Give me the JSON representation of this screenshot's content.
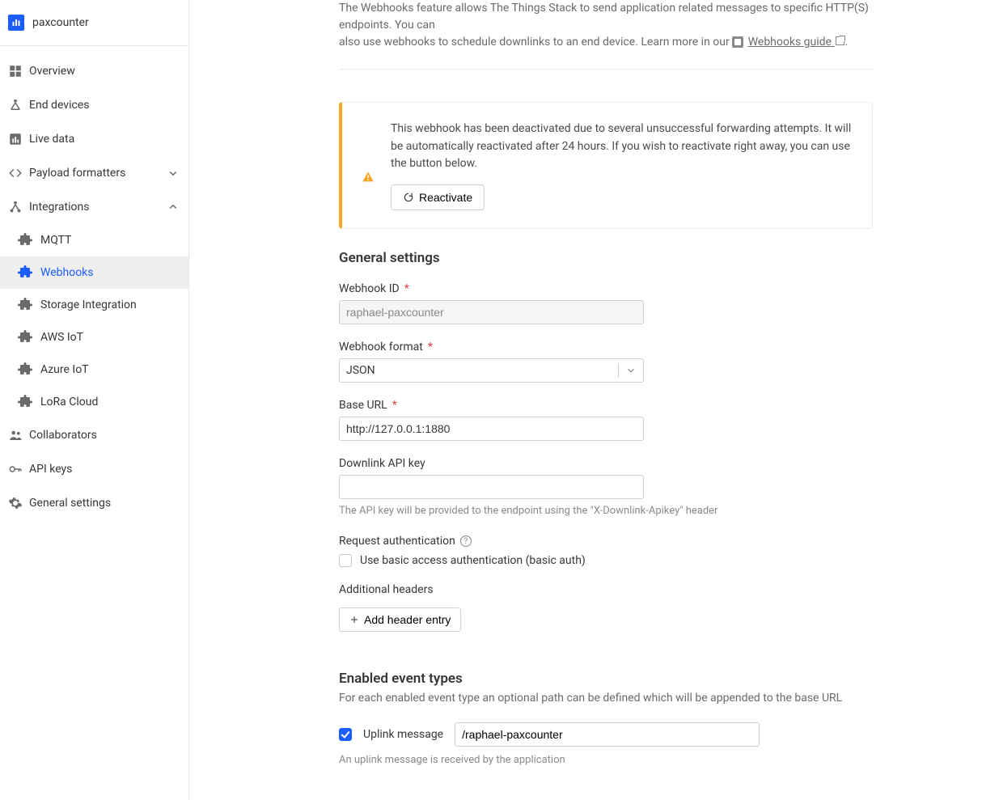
{
  "sidebar": {
    "app_name": "paxcounter",
    "items": {
      "overview": "Overview",
      "end_devices": "End devices",
      "live_data": "Live data",
      "payload_formatters": "Payload formatters",
      "integrations": "Integrations",
      "collaborators": "Collaborators",
      "api_keys": "API keys",
      "general_settings": "General settings"
    },
    "integrations": {
      "mqtt": "MQTT",
      "webhooks": "Webhooks",
      "storage_integration": "Storage Integration",
      "aws_iot": "AWS IoT",
      "azure_iot": "Azure IoT",
      "lora_cloud": "LoRa Cloud"
    }
  },
  "intro": {
    "line1": "The Webhooks feature allows The Things Stack to send application related messages to specific HTTP(S) endpoints. You can",
    "line2_prefix": "also use webhooks to schedule downlinks to an end device. Learn more in our ",
    "link_text": "Webhooks guide",
    "line2_suffix": "."
  },
  "alert": {
    "text": "This webhook has been deactivated due to several unsuccessful forwarding attempts. It will be automatically reactivated after 24 hours. If you wish to reactivate right away, you can use the button below.",
    "button": "Reactivate"
  },
  "sections": {
    "general": "General settings",
    "enabled_events": "Enabled event types",
    "enabled_events_desc": "For each enabled event type an optional path can be defined which will be appended to the base URL"
  },
  "fields": {
    "webhook_id": {
      "label": "Webhook ID",
      "value": "raphael-paxcounter"
    },
    "webhook_format": {
      "label": "Webhook format",
      "value": "JSON"
    },
    "base_url": {
      "label": "Base URL",
      "value": "http://127.0.0.1:1880"
    },
    "downlink_api_key": {
      "label": "Downlink API key",
      "value": "",
      "hint": "The API key will be provided to the endpoint using the \"X-Downlink-Apikey\" header"
    },
    "request_auth": {
      "label": "Request authentication",
      "checkbox_label": "Use basic access authentication (basic auth)"
    },
    "additional_headers": {
      "label": "Additional headers",
      "button": "Add header entry"
    },
    "uplink": {
      "label": "Uplink message",
      "value": "/raphael-paxcounter",
      "hint": "An uplink message is received by the application"
    }
  }
}
